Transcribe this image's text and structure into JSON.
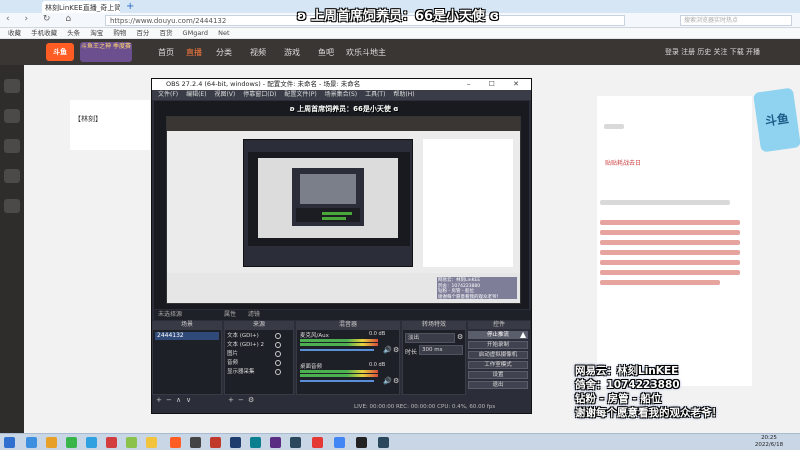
{
  "browser": {
    "tab_title": "林刻LinKEE直播_奇上简...",
    "new_tab_symbol": "+",
    "nav_glyphs": "‹ › ↻ ⌂",
    "url": "https://www.douyu.com/2444132",
    "right_search_placeholder": "搜索浏览器实时热点",
    "bookmarks": [
      "收藏",
      "手机收藏",
      "头条",
      "淘宝",
      "购物",
      "百分",
      "百货",
      "GMgard",
      "Net"
    ]
  },
  "site": {
    "logo_text": "斗鱼",
    "banner_text": "斗鱼王之神 季度赛",
    "nav": [
      "首页",
      "直播",
      "分类",
      "视频",
      "游戏",
      "鱼吧",
      "欢乐斗地主"
    ],
    "user_area_text": "登录 注册 历史 关注 下载 开播",
    "room_title": "【林刻】",
    "right_panel_title": "贴贴耗战去日",
    "right_deco_text": "斗鱼"
  },
  "overlay": {
    "top_text": "ʚ 上周首席饲养员：66是小天使 ɞ"
  },
  "obs": {
    "title": "OBS 27.2.4 (64-bit, windows) - 配置文件: 未命名 - 场景: 未命名",
    "window_buttons": "– ☐ ✕",
    "menu": [
      "文件(F)",
      "编辑(E)",
      "视图(V)",
      "停靠窗口(D)",
      "配置文件(P)",
      "场景集合(S)",
      "工具(T)",
      "帮助(H)"
    ],
    "preview_overlay": "ʚ 上周首席饲养员：66是小天使 ɞ",
    "nested_overlay_lines": [
      "网易云：林刻LinKEE",
      "鸽舍：1074223880",
      "钻粉 - 房管 - 船位",
      "谢谢每个愿意看我的观众老爷！"
    ],
    "infobar": "未选择源",
    "infobar_buttons": [
      "属性",
      "滤镜"
    ],
    "docks": {
      "scenes": "场景",
      "sources": "来源",
      "mixer": "混音器",
      "transitions": "转场特效",
      "controls": "控件"
    },
    "scene_list": [
      "2444132"
    ],
    "sources": [
      "文本 (GDI+)",
      "文本 (GDI+) 2",
      "图片",
      "音频",
      "显示器采集"
    ],
    "mixer": [
      {
        "name": "麦克风/Aux",
        "db": "0.0 dB"
      },
      {
        "name": "桌面音频",
        "db": "0.0 dB"
      }
    ],
    "transition_type": "淡出",
    "transition_duration_label": "时长",
    "transition_duration": "300 ms",
    "controls": [
      "停止推流",
      "开始录制",
      "启动虚拟摄像机",
      "工作室模式",
      "设置",
      "退出"
    ],
    "dock_toolbar_glyphs": [
      "+",
      "−",
      "∧",
      "∨",
      "⚙"
    ],
    "status": "LIVE: 00:00:00   REC: 00:00:00   CPU: 0.4%, 60.00 fps"
  },
  "stream_info": {
    "lines": [
      "网易云：林刻LinKEE",
      "鸽舍：1074223880",
      "钻粉 - 房管 - 船位",
      "谢谢每个愿意看我的观众老爷！"
    ]
  },
  "taskbar": {
    "time": "20:25",
    "date": "2022/6/18"
  },
  "colors": {
    "obs_bg": "#2b2e38",
    "douyu_orange": "#ff5d23",
    "site_header": "#3a3634",
    "taskbar": "#c8d6e6"
  }
}
